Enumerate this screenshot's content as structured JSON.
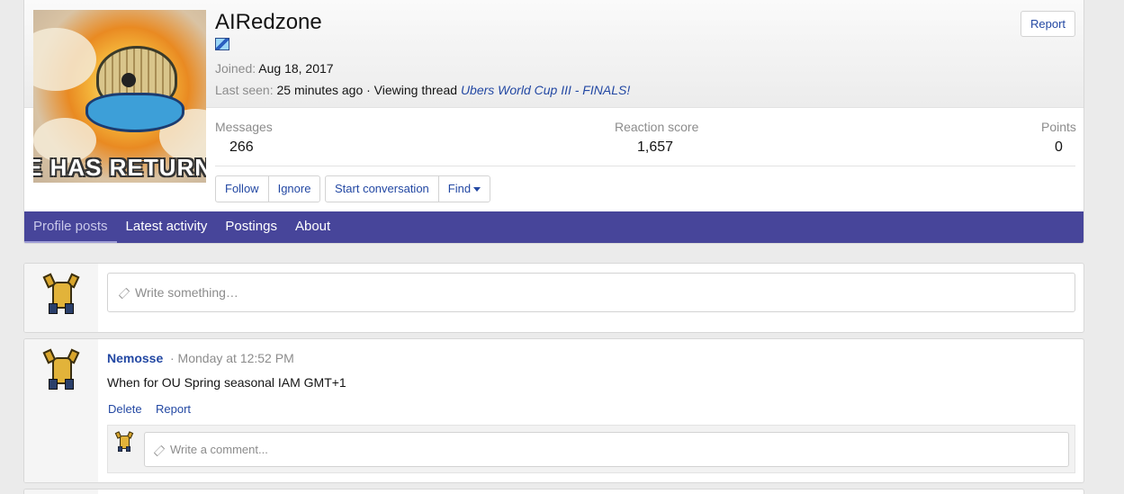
{
  "profile": {
    "username": "AIRedzone",
    "avatar_caption": "E HAS RETURNI",
    "joined_label": "Joined:",
    "joined_value": "Aug 18, 2017",
    "last_seen_label": "Last seen:",
    "last_seen_value": "25 minutes ago · Viewing thread",
    "last_seen_thread": "Ubers World Cup III - FINALS!",
    "report_label": "Report",
    "stats": [
      {
        "label": "Messages",
        "value": "266"
      },
      {
        "label": "Reaction score",
        "value": "1,657"
      },
      {
        "label": "Points",
        "value": "0"
      }
    ],
    "buttons": {
      "follow": "Follow",
      "ignore": "Ignore",
      "start_conversation": "Start conversation",
      "find": "Find"
    }
  },
  "tabs": [
    {
      "label": "Profile posts",
      "active": true
    },
    {
      "label": "Latest activity",
      "active": false
    },
    {
      "label": "Postings",
      "active": false
    },
    {
      "label": "About",
      "active": false
    }
  ],
  "composer": {
    "placeholder": "Write something…"
  },
  "post": {
    "author": "Nemosse",
    "time": "· Monday at 12:52 PM",
    "body": "When for OU Spring seasonal IAM GMT+1",
    "delete_label": "Delete",
    "report_label": "Report",
    "comment_placeholder": "Write a comment..."
  },
  "colors": {
    "accent": "#47459a",
    "link": "#2348a3"
  }
}
